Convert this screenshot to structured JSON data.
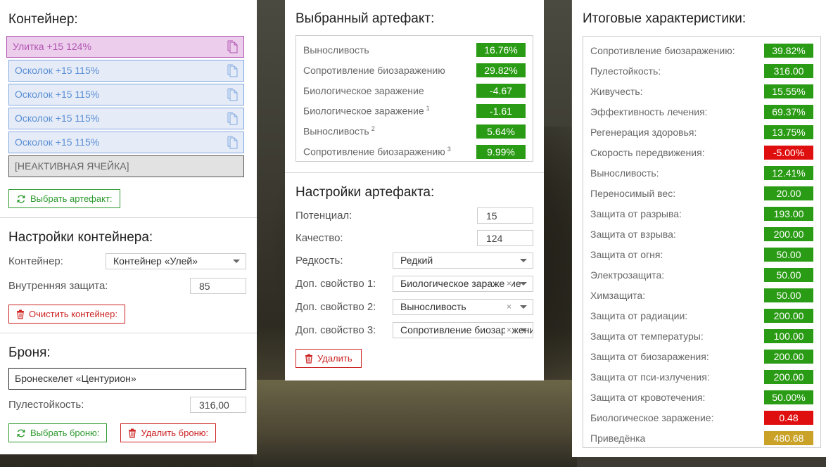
{
  "container": {
    "title": "Контейнер:",
    "slots": [
      {
        "label": "Улитка +15 124%",
        "state": "active"
      },
      {
        "label": "Осколок +15 115%",
        "state": "normal"
      },
      {
        "label": "Осколок +15 115%",
        "state": "normal"
      },
      {
        "label": "Осколок +15 115%",
        "state": "normal"
      },
      {
        "label": "Осколок +15 115%",
        "state": "normal"
      },
      {
        "label": "[НЕАКТИВНАЯ ЯЧЕЙКА]",
        "state": "inactive"
      }
    ],
    "select_artifact_label": "Выбрать артефакт:"
  },
  "container_settings": {
    "title": "Настройки контейнера:",
    "container_label": "Контейнер:",
    "container_value": "Контейнер «Улей»",
    "inner_protection_label": "Внутренняя защита:",
    "inner_protection_value": "85",
    "clear_label": "Очистить контейнер:"
  },
  "armor": {
    "title": "Броня:",
    "name": "Бронескелет «Центурион»",
    "bulletproof_label": "Пулестойкость:",
    "bulletproof_value": "316,00",
    "select_label": "Выбрать броню:",
    "delete_label": "Удалить броню:"
  },
  "selected_artifact": {
    "title": "Выбранный артефакт:",
    "stats": [
      {
        "label": "Выносливость",
        "sup": "",
        "value": "16.76%",
        "color": "green"
      },
      {
        "label": "Сопротивление биозаражению",
        "sup": "",
        "value": "29.82%",
        "color": "green"
      },
      {
        "label": "Биологическое заражение",
        "sup": "",
        "value": "-4.67",
        "color": "green"
      },
      {
        "label": "Биологическое заражение",
        "sup": "1",
        "value": "-1.61",
        "color": "green"
      },
      {
        "label": "Выносливость",
        "sup": "2",
        "value": "5.64%",
        "color": "green"
      },
      {
        "label": "Сопротивление биозаражению",
        "sup": "3",
        "value": "9.99%",
        "color": "green"
      }
    ]
  },
  "artifact_settings": {
    "title": "Настройки артефакта:",
    "potential_label": "Потенциал:",
    "potential_value": "15",
    "quality_label": "Качество:",
    "quality_value": "124",
    "rarity_label": "Редкость:",
    "rarity_value": "Редкий",
    "prop1_label": "Доп. свойство 1:",
    "prop1_value": "Биологическое заражение",
    "prop2_label": "Доп. свойство 2:",
    "prop2_value": "Выносливость",
    "prop3_label": "Доп. свойство 3:",
    "prop3_value": "Сопротивление биозаражению",
    "delete_label": "Удалить"
  },
  "totals": {
    "title": "Итоговые характеристики:",
    "stats": [
      {
        "label": "Сопротивление биозаражению:",
        "value": "39.82%",
        "color": "green"
      },
      {
        "label": "Пулестойкость:",
        "value": "316.00",
        "color": "green"
      },
      {
        "label": "Живучесть:",
        "value": "15.55%",
        "color": "green"
      },
      {
        "label": "Эффективность лечения:",
        "value": "69.37%",
        "color": "green"
      },
      {
        "label": "Регенерация здоровья:",
        "value": "13.75%",
        "color": "green"
      },
      {
        "label": "Скорость передвижения:",
        "value": "-5.00%",
        "color": "red"
      },
      {
        "label": "Выносливость:",
        "value": "12.41%",
        "color": "green"
      },
      {
        "label": "Переносимый вес:",
        "value": "20.00",
        "color": "green"
      },
      {
        "label": "Защита от разрыва:",
        "value": "193.00",
        "color": "green"
      },
      {
        "label": "Защита от взрыва:",
        "value": "200.00",
        "color": "green"
      },
      {
        "label": "Защита от огня:",
        "value": "50.00",
        "color": "green"
      },
      {
        "label": "Электрозащита:",
        "value": "50.00",
        "color": "green"
      },
      {
        "label": "Химзащита:",
        "value": "50.00",
        "color": "green"
      },
      {
        "label": "Защита от радиации:",
        "value": "200.00",
        "color": "green"
      },
      {
        "label": "Защита от температуры:",
        "value": "100.00",
        "color": "green"
      },
      {
        "label": "Защита от биозаражения:",
        "value": "200.00",
        "color": "green"
      },
      {
        "label": "Защита от пси-излучения:",
        "value": "200.00",
        "color": "green"
      },
      {
        "label": "Защита от кровотечения:",
        "value": "50.00%",
        "color": "green"
      },
      {
        "label": "Биологическое заражение:",
        "value": "0.48",
        "color": "red"
      },
      {
        "label": "Приведёнка",
        "value": "480.68",
        "color": "yellow"
      }
    ]
  },
  "icons": {
    "copy": "copy-icon",
    "refresh": "refresh-icon",
    "trash": "trash-icon",
    "clear": "×"
  },
  "colors": {
    "green": "#2a9b14",
    "red": "#e00f0f",
    "yellow": "#c9a227",
    "active_slot": "#eccdec",
    "slot": "#e6ecf7"
  }
}
